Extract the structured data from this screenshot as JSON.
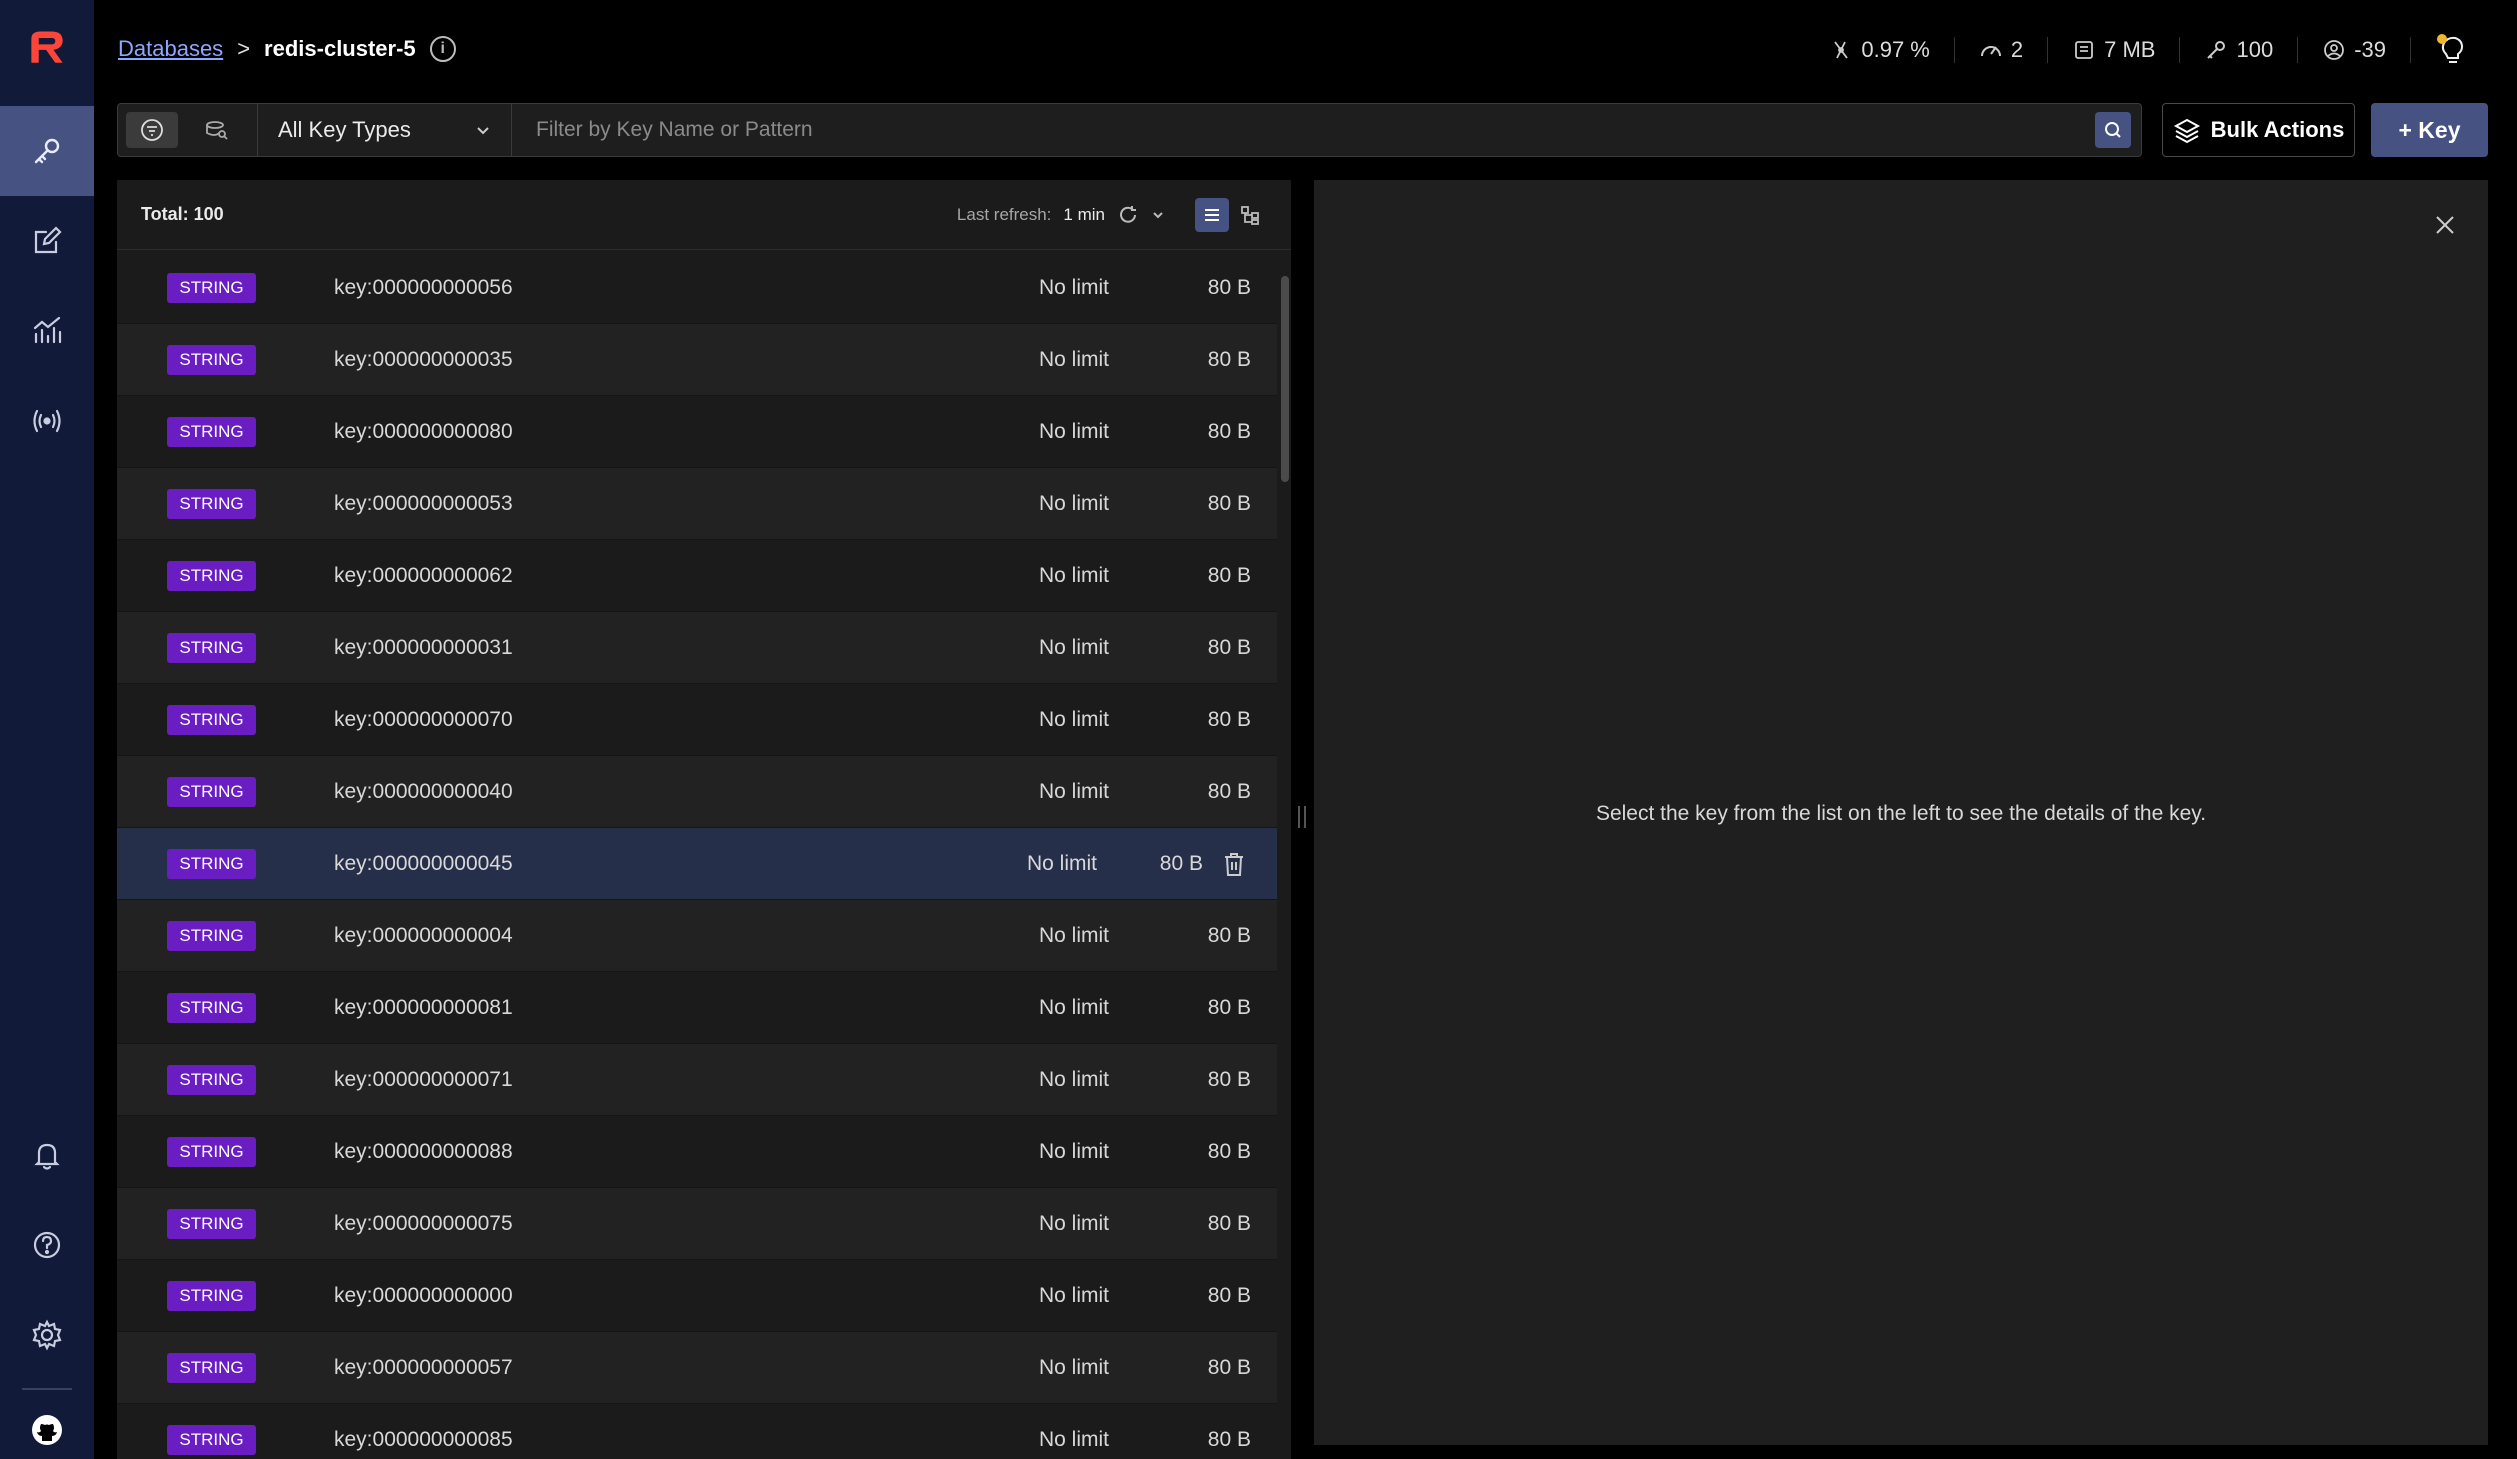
{
  "header": {
    "breadcrumb_link": "Databases",
    "breadcrumb_sep": ">",
    "database_name": "redis-cluster-5",
    "info_glyph": "i",
    "stats": {
      "cpu": "0.97 %",
      "ops": "2",
      "memory": "7 MB",
      "keys": "100",
      "clients": "-39"
    }
  },
  "toolbar": {
    "key_type_select": "All Key Types",
    "search_placeholder": "Filter by Key Name or Pattern",
    "bulk_actions_label": "Bulk Actions",
    "add_key_label": "+ Key"
  },
  "list": {
    "total_label": "Total: 100",
    "last_refresh_label": "Last refresh:",
    "last_refresh_value": "1 min",
    "rows": [
      {
        "type": "STRING",
        "key": "key:000000000056",
        "ttl": "No limit",
        "size": "80 B"
      },
      {
        "type": "STRING",
        "key": "key:000000000035",
        "ttl": "No limit",
        "size": "80 B"
      },
      {
        "type": "STRING",
        "key": "key:000000000080",
        "ttl": "No limit",
        "size": "80 B"
      },
      {
        "type": "STRING",
        "key": "key:000000000053",
        "ttl": "No limit",
        "size": "80 B"
      },
      {
        "type": "STRING",
        "key": "key:000000000062",
        "ttl": "No limit",
        "size": "80 B"
      },
      {
        "type": "STRING",
        "key": "key:000000000031",
        "ttl": "No limit",
        "size": "80 B"
      },
      {
        "type": "STRING",
        "key": "key:000000000070",
        "ttl": "No limit",
        "size": "80 B"
      },
      {
        "type": "STRING",
        "key": "key:000000000040",
        "ttl": "No limit",
        "size": "80 B"
      },
      {
        "type": "STRING",
        "key": "key:000000000045",
        "ttl": "No limit",
        "size": "80 B"
      },
      {
        "type": "STRING",
        "key": "key:000000000004",
        "ttl": "No limit",
        "size": "80 B"
      },
      {
        "type": "STRING",
        "key": "key:000000000081",
        "ttl": "No limit",
        "size": "80 B"
      },
      {
        "type": "STRING",
        "key": "key:000000000071",
        "ttl": "No limit",
        "size": "80 B"
      },
      {
        "type": "STRING",
        "key": "key:000000000088",
        "ttl": "No limit",
        "size": "80 B"
      },
      {
        "type": "STRING",
        "key": "key:000000000075",
        "ttl": "No limit",
        "size": "80 B"
      },
      {
        "type": "STRING",
        "key": "key:000000000000",
        "ttl": "No limit",
        "size": "80 B"
      },
      {
        "type": "STRING",
        "key": "key:000000000057",
        "ttl": "No limit",
        "size": "80 B"
      },
      {
        "type": "STRING",
        "key": "key:000000000085",
        "ttl": "No limit",
        "size": "80 B"
      }
    ]
  },
  "details": {
    "empty_message": "Select the key from the list on the left to see the details of the key."
  },
  "colors": {
    "accent": "#465282",
    "string_badge": "#6a1dc3",
    "link": "#8ba7ff",
    "notification_dot": "#f3b52b"
  }
}
